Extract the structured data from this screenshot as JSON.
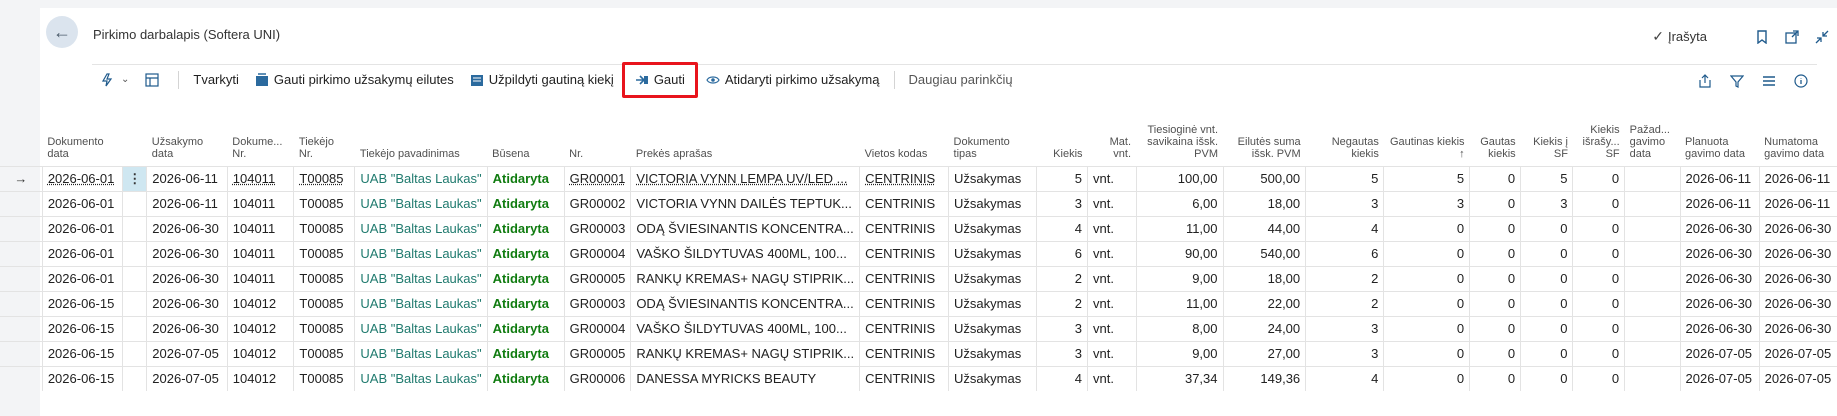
{
  "header": {
    "title": "Pirkimo darbalapis (Softera UNI)",
    "saved_label": "Įrašyta",
    "icons": [
      "back-arrow-icon",
      "bookmark-icon",
      "open-new-window-icon",
      "collapse-icon"
    ]
  },
  "commands": {
    "edit": "Tvarkyti",
    "get_lines": "Gauti pirkimo užsakymų eilutes",
    "fill_qty": "Užpildyti gautiną kiekį",
    "receive": "Gauti",
    "open_order": "Atidaryti pirkimo užsakymą",
    "more": "Daugiau parinkčių"
  },
  "accent_colors": {
    "link": "#1f7a6e",
    "status": "#107c10",
    "highlight": "#e8141c"
  },
  "columns": [
    "Dokumento data",
    "Užsakymo data",
    "Dokume... Nr.",
    "Tiekėjo Nr.",
    "Tiekėjo pavadinimas",
    "Būsena",
    "Nr.",
    "Prekės aprašas",
    "Vietos kodas",
    "Dokumento tipas",
    "Kiekis",
    "Mat. vnt.",
    "Tiesioginė vnt. savikaina išsk. PVM",
    "Eilutės suma išsk. PVM",
    "Negautas kiekis",
    "Gautinas kiekis ↑",
    "Gautas kiekis",
    "Kiekis į SF",
    "Kiekis išrašy... SF",
    "Pažad... gavimo data",
    "Planuota gavimo data",
    "Numatoma gavimo data"
  ],
  "rows": [
    [
      "2026-06-01",
      "2026-06-11",
      "104011",
      "T00085",
      "UAB \"Baltas Laukas\"",
      "Atidaryta",
      "GR00001",
      "VICTORIA VYNN LEMPA UV/LED ...",
      "CENTRINIS",
      "Užsakymas",
      "5",
      "vnt.",
      "100,00",
      "500,00",
      "5",
      "5",
      "0",
      "5",
      "0",
      "",
      "2026-06-11",
      "2026-06-11"
    ],
    [
      "2026-06-01",
      "2026-06-11",
      "104011",
      "T00085",
      "UAB \"Baltas Laukas\"",
      "Atidaryta",
      "GR00002",
      "VICTORIA VYNN DAILĖS TEPTUK...",
      "CENTRINIS",
      "Užsakymas",
      "3",
      "vnt.",
      "6,00",
      "18,00",
      "3",
      "3",
      "0",
      "3",
      "0",
      "",
      "2026-06-11",
      "2026-06-11"
    ],
    [
      "2026-06-01",
      "2026-06-30",
      "104011",
      "T00085",
      "UAB \"Baltas Laukas\"",
      "Atidaryta",
      "GR00003",
      "ODĄ ŠVIESINANTIS KONCENTRA...",
      "CENTRINIS",
      "Užsakymas",
      "4",
      "vnt.",
      "11,00",
      "44,00",
      "4",
      "0",
      "0",
      "0",
      "0",
      "",
      "2026-06-30",
      "2026-06-30"
    ],
    [
      "2026-06-01",
      "2026-06-30",
      "104011",
      "T00085",
      "UAB \"Baltas Laukas\"",
      "Atidaryta",
      "GR00004",
      "VAŠKO ŠILDYTUVAS 400ML, 100...",
      "CENTRINIS",
      "Užsakymas",
      "6",
      "vnt.",
      "90,00",
      "540,00",
      "6",
      "0",
      "0",
      "0",
      "0",
      "",
      "2026-06-30",
      "2026-06-30"
    ],
    [
      "2026-06-01",
      "2026-06-30",
      "104011",
      "T00085",
      "UAB \"Baltas Laukas\"",
      "Atidaryta",
      "GR00005",
      "RANKŲ KREMAS+ NAGŲ STIPRIK...",
      "CENTRINIS",
      "Užsakymas",
      "2",
      "vnt.",
      "9,00",
      "18,00",
      "2",
      "0",
      "0",
      "0",
      "0",
      "",
      "2026-06-30",
      "2026-06-30"
    ],
    [
      "2026-06-15",
      "2026-06-30",
      "104012",
      "T00085",
      "UAB \"Baltas Laukas\"",
      "Atidaryta",
      "GR00003",
      "ODĄ ŠVIESINANTIS KONCENTRA...",
      "CENTRINIS",
      "Užsakymas",
      "2",
      "vnt.",
      "11,00",
      "22,00",
      "2",
      "0",
      "0",
      "0",
      "0",
      "",
      "2026-06-30",
      "2026-06-30"
    ],
    [
      "2026-06-15",
      "2026-06-30",
      "104012",
      "T00085",
      "UAB \"Baltas Laukas\"",
      "Atidaryta",
      "GR00004",
      "VAŠKO ŠILDYTUVAS 400ML, 100...",
      "CENTRINIS",
      "Užsakymas",
      "3",
      "vnt.",
      "8,00",
      "24,00",
      "3",
      "0",
      "0",
      "0",
      "0",
      "",
      "2026-06-30",
      "2026-06-30"
    ],
    [
      "2026-06-15",
      "2026-07-05",
      "104012",
      "T00085",
      "UAB \"Baltas Laukas\"",
      "Atidaryta",
      "GR00005",
      "RANKŲ KREMAS+ NAGŲ STIPRIK...",
      "CENTRINIS",
      "Užsakymas",
      "3",
      "vnt.",
      "9,00",
      "27,00",
      "3",
      "0",
      "0",
      "0",
      "0",
      "",
      "2026-07-05",
      "2026-07-05"
    ],
    [
      "2026-06-15",
      "2026-07-05",
      "104012",
      "T00085",
      "UAB \"Baltas Laukas\"",
      "Atidaryta",
      "GR00006",
      "DANESSA MYRICKS BEAUTY",
      "CENTRINIS",
      "Užsakymas",
      "4",
      "vnt.",
      "37,34",
      "149,36",
      "4",
      "0",
      "0",
      "0",
      "0",
      "",
      "2026-07-05",
      "2026-07-05"
    ]
  ]
}
